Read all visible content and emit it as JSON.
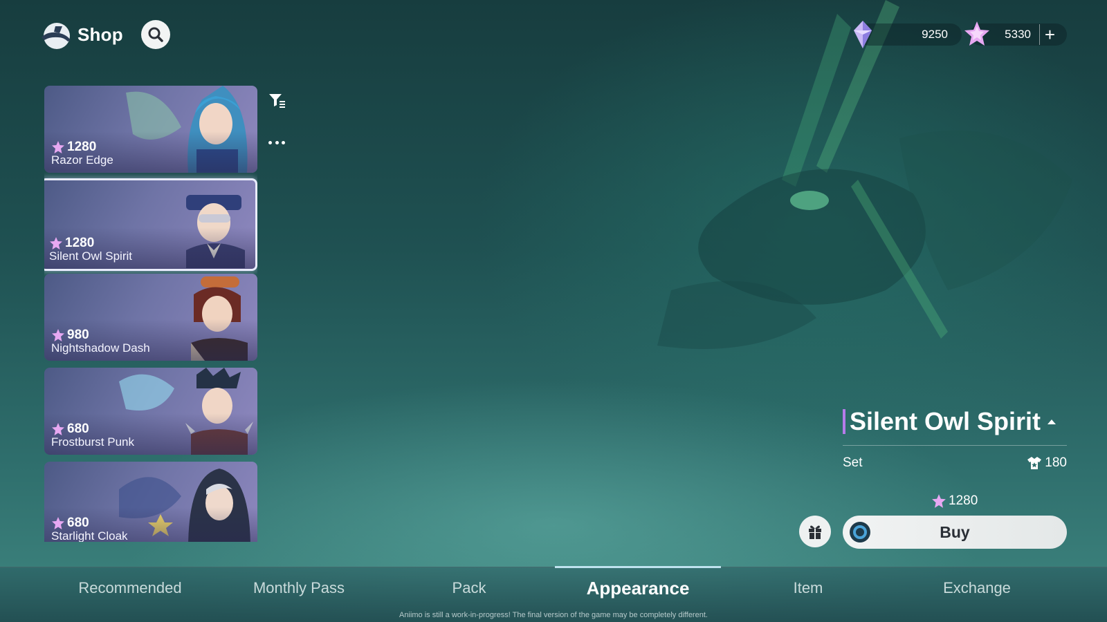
{
  "header": {
    "title": "Shop"
  },
  "currency": {
    "gems": "9250",
    "stars": "5330",
    "add_label": "+"
  },
  "skins": [
    {
      "price": "1280",
      "name": "Razor Edge"
    },
    {
      "price": "1280",
      "name": "Silent Owl Spirit"
    },
    {
      "price": "980",
      "name": "Nightshadow Dash"
    },
    {
      "price": "680",
      "name": "Frostburst Punk"
    },
    {
      "price": "680",
      "name": "Starlight Cloak"
    }
  ],
  "detail": {
    "title": "Silent Owl Spirit",
    "type_label": "Set",
    "appearance_points": "180",
    "price": "1280",
    "buy_label": "Buy"
  },
  "tabs": [
    {
      "label": "Recommended"
    },
    {
      "label": "Monthly Pass"
    },
    {
      "label": "Pack"
    },
    {
      "label": "Appearance"
    },
    {
      "label": "Item"
    },
    {
      "label": "Exchange"
    }
  ],
  "disclaimer": "Aniimo is still a work-in-progress! The final version of the game may be completely different.",
  "colors": {
    "accent": "#b67bea",
    "star": "#d9a8f0",
    "active_tab_indicator": "#bfe3ef"
  }
}
